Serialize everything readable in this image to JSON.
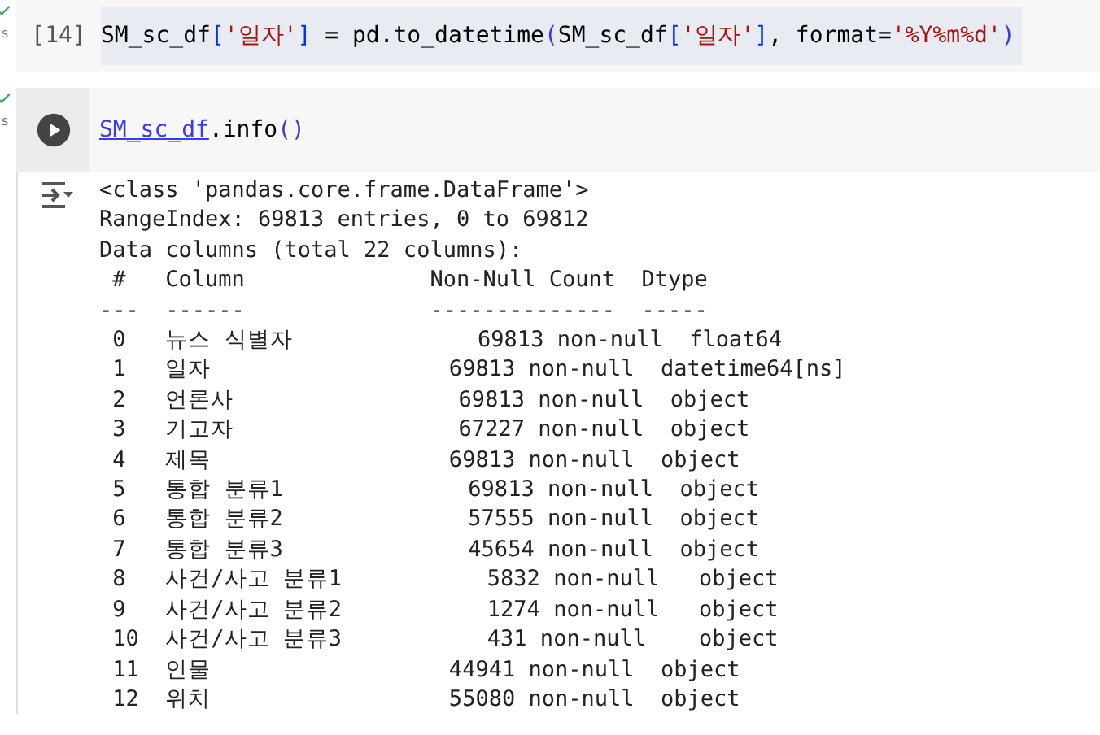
{
  "cells": [
    {
      "kind": "done",
      "status_text": "s",
      "exec_count": "[14]",
      "code": [
        {
          "kind": "plain",
          "text": "SM_sc_df"
        },
        {
          "kind": "bracket",
          "text": "["
        },
        {
          "kind": "string",
          "text": "'일자'"
        },
        {
          "kind": "bracket",
          "text": "]"
        },
        {
          "kind": "plain",
          "text": " = pd.to_datetime"
        },
        {
          "kind": "paren",
          "text": "("
        },
        {
          "kind": "plain",
          "text": "SM_sc_df"
        },
        {
          "kind": "bracket",
          "text": "["
        },
        {
          "kind": "string",
          "text": "'일자'"
        },
        {
          "kind": "bracket",
          "text": "]"
        },
        {
          "kind": "plain",
          "text": ", format="
        },
        {
          "kind": "string",
          "text": "'%Y%m%d'"
        },
        {
          "kind": "paren",
          "text": ")"
        }
      ],
      "selected": true
    },
    {
      "kind": "run",
      "status_text": "s",
      "code": [
        {
          "kind": "link",
          "text": "SM_sc_df"
        },
        {
          "kind": "plain",
          "text": ".info"
        },
        {
          "kind": "paren",
          "text": "()"
        }
      ],
      "selected": false,
      "output": [
        "<class 'pandas.core.frame.DataFrame'>",
        "RangeIndex: 69813 entries, 0 to 69812",
        "Data columns (total 22 columns):",
        " #   Column              Non-Null Count  Dtype",
        "---  ------              --------------  -----",
        " 0   뉴스 식별자              69813 non-null  float64",
        " 1   일자                  69813 non-null  datetime64[ns]",
        " 2   언론사                 69813 non-null  object",
        " 3   기고자                 67227 non-null  object",
        " 4   제목                  69813 non-null  object",
        " 5   통합 분류1              69813 non-null  object",
        " 6   통합 분류2              57555 non-null  object",
        " 7   통합 분류3              45654 non-null  object",
        " 8   사건/사고 분류1           5832 non-null   object",
        " 9   사건/사고 분류2           1274 non-null   object",
        " 10  사건/사고 분류3           431 non-null    object",
        " 11  인물                  44941 non-null  object",
        " 12  위치                  55080 non-null  object"
      ]
    }
  ]
}
